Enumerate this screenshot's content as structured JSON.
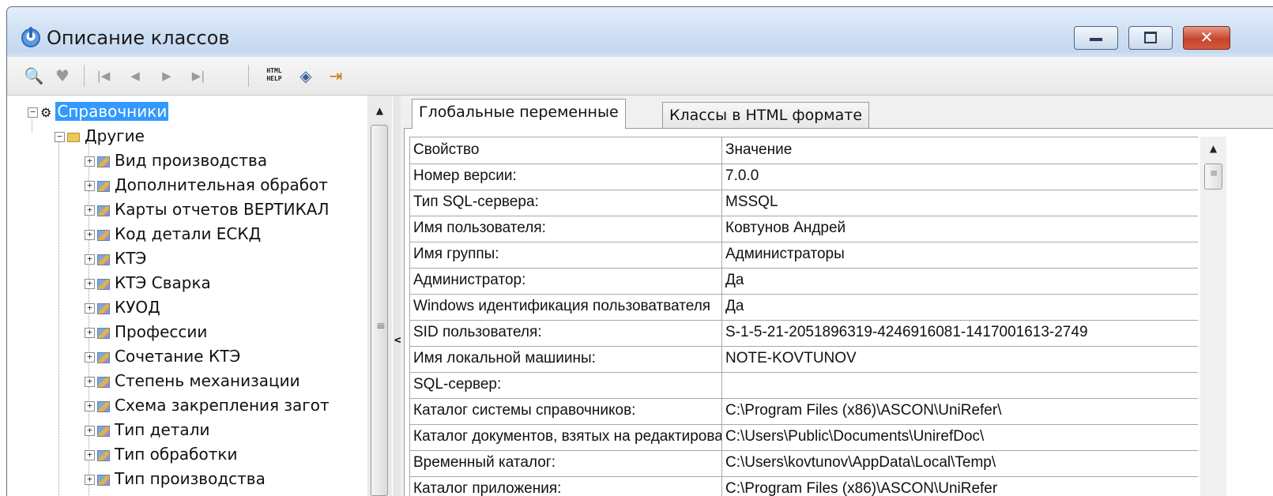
{
  "window": {
    "title": "Описание классов"
  },
  "caption_buttons": {
    "close_glyph": "✕"
  },
  "toolbar": {
    "items": [
      {
        "icon": "find-icon",
        "glyph": "🔍"
      },
      {
        "icon": "filter-icon",
        "glyph": "♥"
      },
      {
        "icon": "first-record-icon",
        "glyph": "|◀"
      },
      {
        "icon": "prev-record-icon",
        "glyph": "◀"
      },
      {
        "icon": "next-record-icon",
        "glyph": "▶"
      },
      {
        "icon": "last-record-icon",
        "glyph": "▶|"
      },
      {
        "icon": "html-help-icon",
        "text_top": "HTML",
        "text_bottom": "HELP"
      },
      {
        "icon": "layers-icon",
        "glyph": "◈"
      },
      {
        "icon": "exit-icon",
        "glyph": "⇥"
      }
    ]
  },
  "tree": {
    "root": {
      "label": "Справочники",
      "expander": "−",
      "selected": true
    },
    "group": {
      "label": "Другие",
      "expander": "−"
    },
    "items": [
      {
        "label": "Вид производства",
        "expander": "+"
      },
      {
        "label": "Дополнительная обработ",
        "expander": "+"
      },
      {
        "label": "Карты отчетов ВЕРТИКАЛ",
        "expander": "+"
      },
      {
        "label": "Код детали ЕСКД",
        "expander": "+"
      },
      {
        "label": "КТЭ",
        "expander": "+"
      },
      {
        "label": "КТЭ Сварка",
        "expander": "+"
      },
      {
        "label": "КУОД",
        "expander": "+"
      },
      {
        "label": "Профессии",
        "expander": "+"
      },
      {
        "label": "Сочетание КТЭ",
        "expander": "+"
      },
      {
        "label": "Степень механизации",
        "expander": "+"
      },
      {
        "label": "Схема закрепления загот",
        "expander": "+"
      },
      {
        "label": "Тип детали",
        "expander": "+"
      },
      {
        "label": "Тип обработки",
        "expander": "+"
      },
      {
        "label": "Тип производства",
        "expander": "+"
      }
    ]
  },
  "scrollbars": {
    "up_arrow": "▲",
    "grip": "≡"
  },
  "splitter": {
    "arrow": "<"
  },
  "tabs": [
    {
      "label": "Глобальные переменные",
      "active": true
    },
    {
      "label": "Классы в HTML формате",
      "active": false
    }
  ],
  "grid": {
    "headers": {
      "property": "Свойство",
      "value": "Значение"
    },
    "rows": [
      {
        "property": "Номер версии:",
        "value": "7.0.0"
      },
      {
        "property": "Тип SQL-сервера:",
        "value": "MSSQL"
      },
      {
        "property": "Имя пользователя:",
        "value": "Ковтунов Андрей"
      },
      {
        "property": "Имя группы:",
        "value": "Администраторы"
      },
      {
        "property": "Администратор:",
        "value": "Да"
      },
      {
        "property": "Windows идентификация пользоватвателя",
        "value": "Да"
      },
      {
        "property": "SID пользователя:",
        "value": "S-1-5-21-2051896319-4246916081-1417001613-2749"
      },
      {
        "property": "Имя локальной машиины:",
        "value": "NOTE-KOVTUNOV"
      },
      {
        "property": "SQL-сервер:",
        "value": ""
      },
      {
        "property": "Каталог системы справочников:",
        "value": "C:\\Program Files (x86)\\ASCON\\UniRefer\\"
      },
      {
        "property": "Каталог документов, взятых на редактирование:",
        "value": "C:\\Users\\Public\\Documents\\UnirefDoc\\"
      },
      {
        "property": "Временный каталог:",
        "value": "C:\\Users\\kovtunov\\AppData\\Local\\Temp\\"
      },
      {
        "property": "Каталог приложения:",
        "value": "C:\\Program Files (x86)\\ASCON\\UniRefer"
      }
    ]
  }
}
